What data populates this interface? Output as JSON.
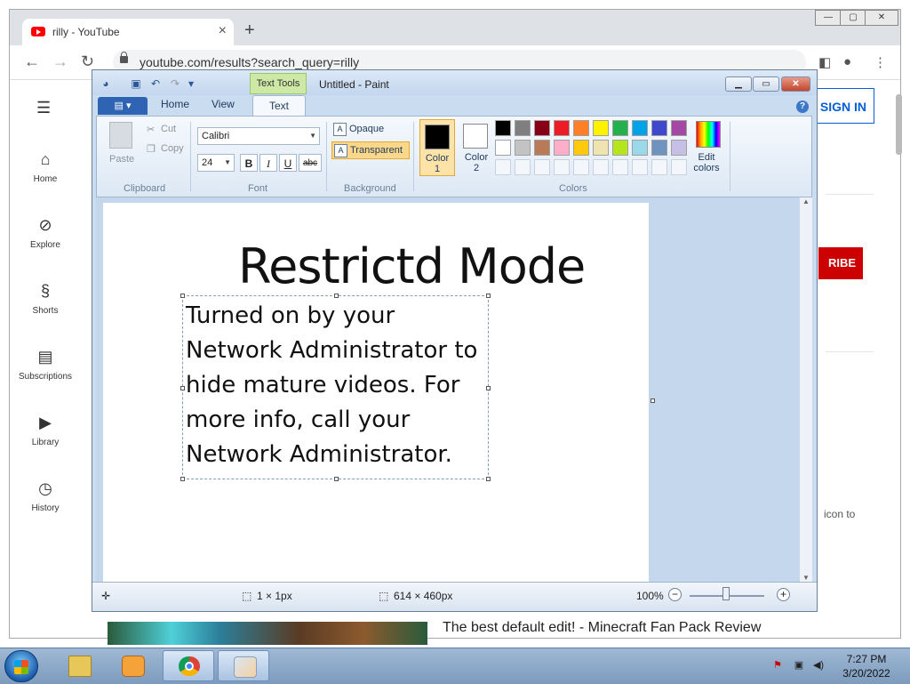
{
  "browser": {
    "tab_title": "rilly - YouTube",
    "url": "youtube.com/results?search_query=rilly",
    "tab_close": "×",
    "new_tab": "+"
  },
  "youtube": {
    "sidebar": [
      {
        "label": "Home",
        "icon": "home-icon"
      },
      {
        "label": "Explore",
        "icon": "compass-icon"
      },
      {
        "label": "Shorts",
        "icon": "shorts-icon"
      },
      {
        "label": "Subscriptions",
        "icon": "subscriptions-icon"
      },
      {
        "label": "Library",
        "icon": "library-icon"
      },
      {
        "label": "History",
        "icon": "history-icon"
      }
    ],
    "sign_in": "SIGN IN",
    "subscribe": "RIBE",
    "icon_to": "icon to",
    "video_title": "The best default edit! - Minecraft Fan Pack Review"
  },
  "paint": {
    "context_tab": "Text Tools",
    "title": "Untitled - Paint",
    "tabs": {
      "home": "Home",
      "view": "View",
      "text": "Text"
    },
    "clipboard": {
      "paste": "Paste",
      "cut": "Cut",
      "copy": "Copy",
      "group": "Clipboard"
    },
    "font": {
      "family": "Calibri",
      "size": "24",
      "bold": "B",
      "italic": "I",
      "underline": "U",
      "strike": "abc",
      "group": "Font"
    },
    "background": {
      "opaque": "Opaque",
      "transparent": "Transparent",
      "group": "Background"
    },
    "colors": {
      "color1_label": "Color\n1",
      "color2_label": "Color\n2",
      "edit_label": "Edit\ncolors",
      "group": "Colors",
      "color1": "#000000",
      "color2": "#ffffff",
      "palette_row1": [
        "#000000",
        "#7f7f7f",
        "#880015",
        "#ed1c24",
        "#ff7f27",
        "#fff200",
        "#22b14c",
        "#00a2e8",
        "#3f48cc",
        "#a349a4"
      ],
      "palette_row2": [
        "#ffffff",
        "#c3c3c3",
        "#b97a57",
        "#ffaec9",
        "#ffc90e",
        "#efe4b0",
        "#b5e61d",
        "#99d9ea",
        "#7092be",
        "#c8bfe7"
      ]
    },
    "canvas": {
      "heading": "Restrictd Mode",
      "body": "Turned on by your\nNetwork Administrator to\nhide mature videos. For\nmore info, call your\nNetwork Administrator."
    },
    "status": {
      "selection": "1 × 1px",
      "canvas_size": "614 × 460px",
      "zoom": "100%"
    }
  },
  "taskbar": {
    "time": "7:27 PM",
    "date": "3/20/2022"
  }
}
